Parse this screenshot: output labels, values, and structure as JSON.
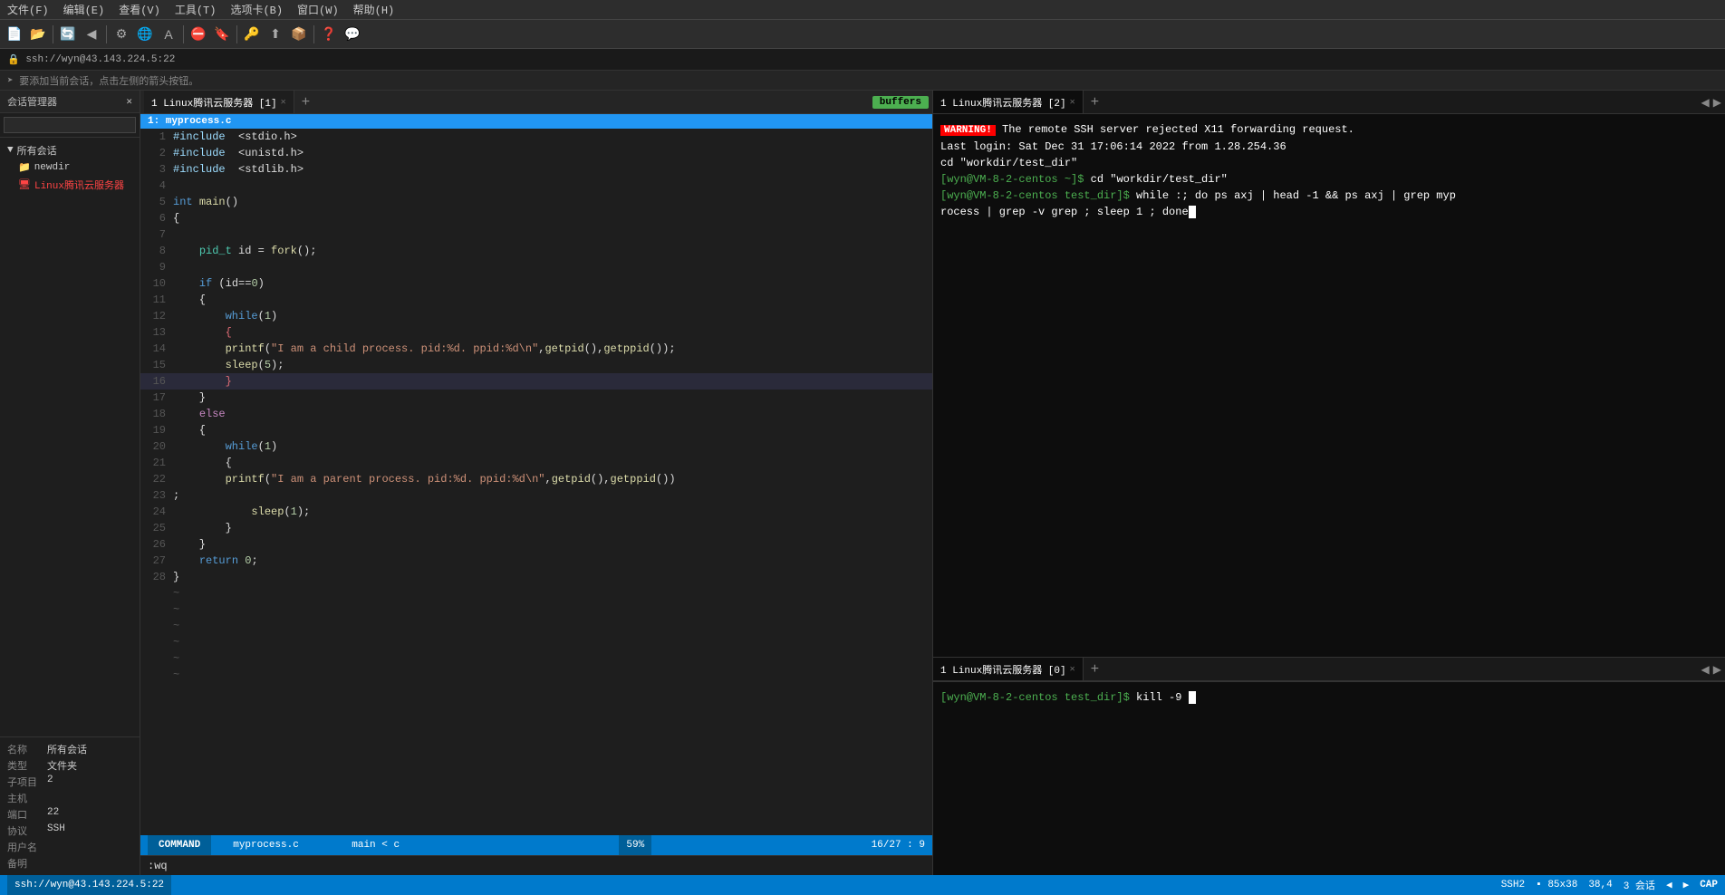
{
  "menu": {
    "items": [
      "文件(F)",
      "编辑(E)",
      "查看(V)",
      "工具(T)",
      "选项卡(B)",
      "窗口(W)",
      "帮助(H)"
    ]
  },
  "address_bar": {
    "text": "ssh://wyn@43.143.224.5:22"
  },
  "notification": {
    "text": "要添加当前会话，点击左侧的箭头按钮。"
  },
  "sidebar": {
    "header": "会话管理器",
    "search_placeholder": "",
    "tree": [
      {
        "label": "所有会话",
        "indent": 0,
        "icon": "▼"
      },
      {
        "label": "newdir",
        "indent": 1,
        "icon": "📁"
      },
      {
        "label": "Linux腾讯云服务器",
        "indent": 1,
        "icon": "🖥"
      }
    ],
    "properties": [
      {
        "label": "名称",
        "value": "所有会话"
      },
      {
        "label": "类型",
        "value": "文件夹"
      },
      {
        "label": "子项目",
        "value": "2"
      },
      {
        "label": "主机",
        "value": ""
      },
      {
        "label": "端口",
        "value": "22"
      },
      {
        "label": "协议",
        "value": "SSH"
      },
      {
        "label": "用户名",
        "value": ""
      },
      {
        "label": "备明",
        "value": ""
      }
    ]
  },
  "editor": {
    "tab_label": "1 Linux腾讯云服务器 [1]",
    "buffer_label": "buffers",
    "file_header": "1: myprocess.c",
    "lines": [
      {
        "num": "1",
        "content": "#include  <stdio.h>",
        "type": "include"
      },
      {
        "num": "2",
        "content": "#include  <unistd.h>",
        "type": "include"
      },
      {
        "num": "3",
        "content": "#include  <stdlib.h>",
        "type": "include"
      },
      {
        "num": "4",
        "content": "",
        "type": "empty"
      },
      {
        "num": "5",
        "content": "int main()",
        "type": "code"
      },
      {
        "num": "6",
        "content": "{",
        "type": "code"
      },
      {
        "num": "7",
        "content": "",
        "type": "empty"
      },
      {
        "num": "8",
        "content": "    pid_t id = fork();",
        "type": "code"
      },
      {
        "num": "9",
        "content": "",
        "type": "empty"
      },
      {
        "num": "10",
        "content": "    if (id==0)",
        "type": "code"
      },
      {
        "num": "11",
        "content": "    {",
        "type": "code"
      },
      {
        "num": "12",
        "content": "        while(1)",
        "type": "code"
      },
      {
        "num": "13",
        "content": "        {",
        "type": "bracket-red"
      },
      {
        "num": "14",
        "content": "        printf(\"I am a child process. pid:%d. ppid:%d\\n\",getpid(),getppid());",
        "type": "code"
      },
      {
        "num": "15",
        "content": "        sleep(5);",
        "type": "code"
      },
      {
        "num": "16",
        "content": "        }",
        "type": "bracket-red-current"
      },
      {
        "num": "17",
        "content": "    }",
        "type": "code"
      },
      {
        "num": "18",
        "content": "    else",
        "type": "code"
      },
      {
        "num": "19",
        "content": "    {",
        "type": "code"
      },
      {
        "num": "20",
        "content": "        while(1)",
        "type": "code"
      },
      {
        "num": "21",
        "content": "        {",
        "type": "code"
      },
      {
        "num": "22",
        "content": "        printf(\"I am a parent process. pid:%d. ppid:%d\\n\",getpid(),getppid())",
        "type": "code"
      },
      {
        "num": "23",
        "content": ";",
        "type": "code"
      },
      {
        "num": "24",
        "content": "            sleep(1);",
        "type": "code"
      },
      {
        "num": "25",
        "content": "        }",
        "type": "code"
      },
      {
        "num": "26",
        "content": "    }",
        "type": "code"
      },
      {
        "num": "27",
        "content": "    return 0;",
        "type": "code"
      },
      {
        "num": "28",
        "content": "}",
        "type": "code"
      }
    ],
    "status": {
      "mode": "COMMAND",
      "filename": "myprocess.c",
      "func": "main < c",
      "percent": "59%",
      "position": "16/27 :  9"
    },
    "cmdline": ":wq"
  },
  "terminal1": {
    "tab_label": "1 Linux腾讯云服务器 [2]",
    "content": [
      {
        "type": "warning",
        "warning_text": "WARNING!",
        "rest": " The remote SSH server rejected X11 forwarding request."
      },
      {
        "type": "plain",
        "text": "Last login: Sat Dec 31 17:06:14 2022 from 1.28.254.36"
      },
      {
        "type": "plain",
        "text": "cd \"workdir/test_dir\""
      },
      {
        "type": "prompt",
        "prompt": "[wyn@VM-8-2-centos ~]$ ",
        "cmd": "cd \"workdir/test_dir\""
      },
      {
        "type": "prompt",
        "prompt": "[wyn@VM-8-2-centos test_dir]$ ",
        "cmd": "while :; do ps axj | head -1 && ps axj | grep myprocess | grep -v grep ; sleep 1 ; done"
      }
    ]
  },
  "terminal2": {
    "tab_label": "1 Linux腾讯云服务器 [0]",
    "content": [
      {
        "type": "prompt",
        "prompt": "[wyn@VM-8-2-centos test_dir]$ ",
        "cmd": "kill -9 "
      }
    ]
  },
  "statusbar": {
    "ssh_text": "ssh://wyn@43.143.224.5:22",
    "ssh2_label": "SSH2",
    "cols": "85x38",
    "row": "38,4",
    "sessions": "3 会话",
    "cap": "CAP"
  }
}
